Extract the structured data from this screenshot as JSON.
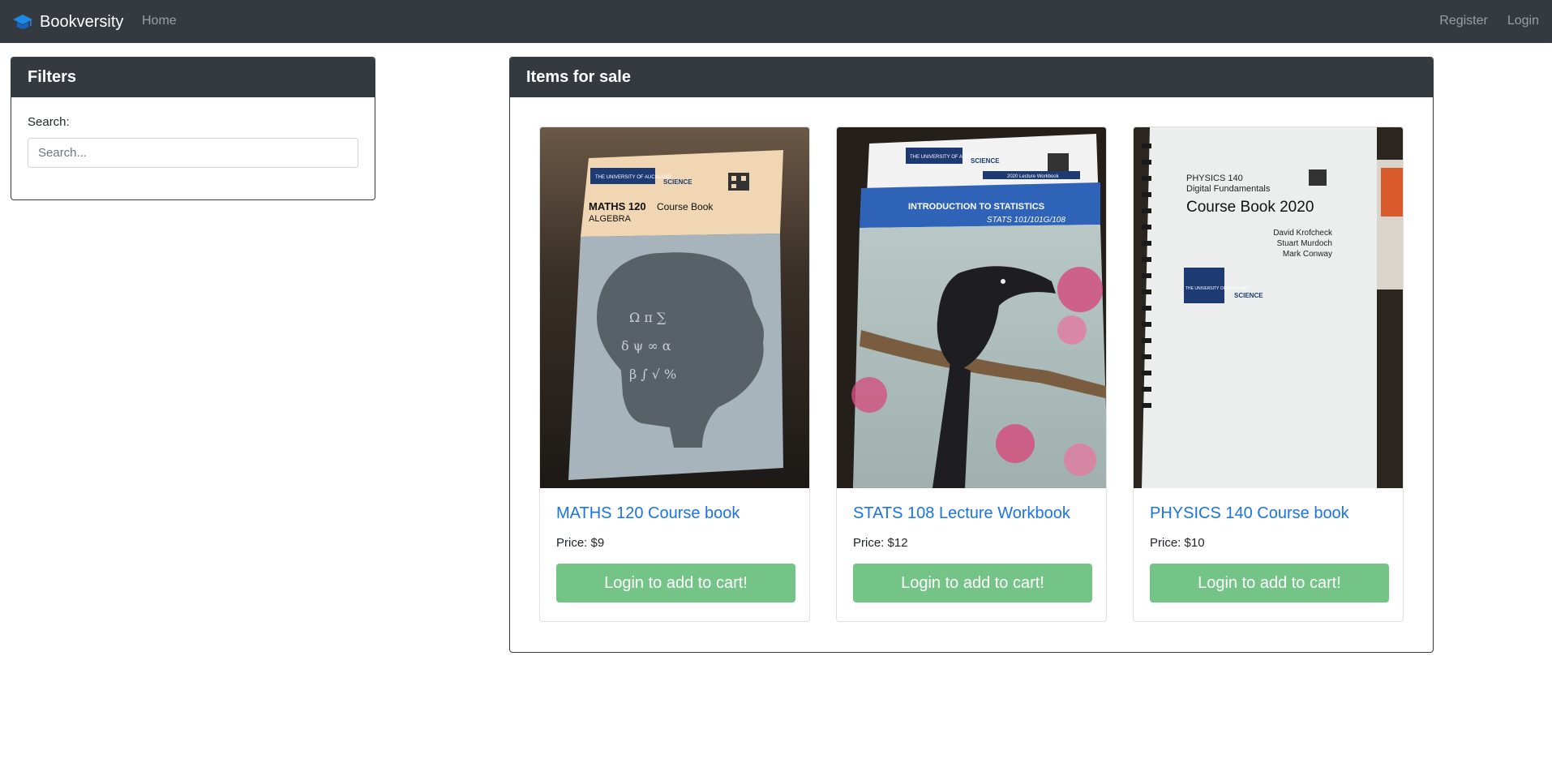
{
  "navbar": {
    "brand": "Bookversity",
    "home": "Home",
    "register": "Register",
    "login": "Login"
  },
  "filters": {
    "title": "Filters",
    "search_label": "Search:",
    "search_placeholder": "Search...",
    "search_value": ""
  },
  "items": {
    "title": "Items for sale",
    "products": [
      {
        "title": "MATHS 120 Course book",
        "price": "Price: $9",
        "button": "Login to add to cart!",
        "cover": {
          "line1": "MATHS 120",
          "line1b": "Course Book",
          "line2": "ALGEBRA",
          "logo": "THE UNIVERSITY OF AUCKLAND",
          "faculty": "SCIENCE"
        }
      },
      {
        "title": "STATS 108 Lecture Workbook",
        "price": "Price: $12",
        "button": "Login to add to cart!",
        "cover": {
          "banner": "2020 Lecture Workbook",
          "line1": "INTRODUCTION TO STATISTICS",
          "line2": "STATS 101/101G/108",
          "logo": "THE UNIVERSITY OF AUCKLAND",
          "faculty": "SCIENCE"
        }
      },
      {
        "title": "PHYSICS 140 Course book",
        "price": "Price: $10",
        "button": "Login to add to cart!",
        "cover": {
          "line1": "PHYSICS 140",
          "line2": "Digital Fundamentals",
          "line3": "Course Book 2020",
          "author1": "David Krofcheck",
          "author2": "Stuart Murdoch",
          "author3": "Mark Conway",
          "logo": "THE UNIVERSITY OF AUCKLAND",
          "faculty": "SCIENCE"
        }
      }
    ]
  },
  "colors": {
    "navbar_bg": "#343a40",
    "link": "#1a73e8",
    "button": "#74c487"
  }
}
